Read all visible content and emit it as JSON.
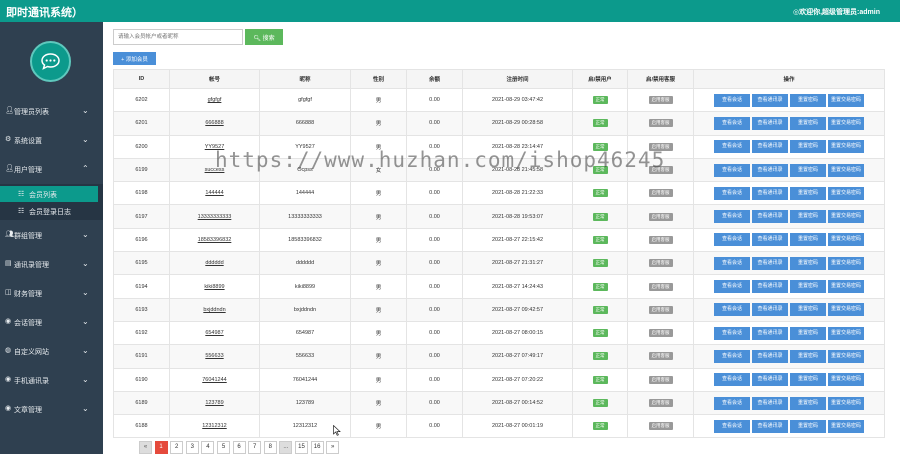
{
  "topbar": {
    "brand": "即时通讯系统）",
    "welcome": "◎欢迎你,超级管理员:admin"
  },
  "sidebar": {
    "items": [
      {
        "label": "管理员列表",
        "icon": "user-icon",
        "arrow": "⌄"
      },
      {
        "label": "系统设置",
        "icon": "gear-icon",
        "arrow": "⌄"
      },
      {
        "label": "用户管理",
        "icon": "user-icon",
        "arrow": "⌃"
      },
      {
        "label": "群组管理",
        "icon": "group-icon",
        "arrow": "⌄"
      },
      {
        "label": "通讯录管理",
        "icon": "book-icon",
        "arrow": "⌄"
      },
      {
        "label": "财务管理",
        "icon": "money-icon",
        "arrow": "⌄"
      },
      {
        "label": "会话管理",
        "icon": "chat-icon",
        "arrow": "⌄"
      },
      {
        "label": "自定义网站",
        "icon": "globe-icon",
        "arrow": "⌄"
      },
      {
        "label": "手机通讯录",
        "icon": "phone-icon",
        "arrow": "⌄"
      },
      {
        "label": "文章管理",
        "icon": "article-icon",
        "arrow": "⌄"
      }
    ],
    "subitems": [
      {
        "label": "会员列表",
        "icon": "list-icon"
      },
      {
        "label": "会员登录日志",
        "icon": "log-icon"
      }
    ]
  },
  "search": {
    "placeholder": "请输入会员帐户或者昵称",
    "button_label": "搜索",
    "add_label": "添加会员"
  },
  "table": {
    "headers": [
      "ID",
      "帐号",
      "昵称",
      "性别",
      "余额",
      "注册时间",
      "启/禁用户",
      "启/禁用客服",
      "操作"
    ],
    "rows": [
      {
        "id": "6202",
        "account": "gfgfgf",
        "nick": "gfgfgf",
        "sex": "男",
        "balance": "0.00",
        "time": "2021-08-29 03:47:42",
        "status": "正常",
        "service": "启用客服"
      },
      {
        "id": "6201",
        "account": "666888",
        "nick": "666888",
        "sex": "男",
        "balance": "0.00",
        "time": "2021-08-29 00:28:58",
        "status": "正常",
        "service": "启用客服"
      },
      {
        "id": "6200",
        "account": "YY9527",
        "nick": "YY9527",
        "sex": "男",
        "balance": "0.00",
        "time": "2021-08-28 23:14:47",
        "status": "正常",
        "service": "启用客服"
      },
      {
        "id": "6199",
        "account": "success",
        "nick": "Ocpss",
        "sex": "女",
        "balance": "0.00",
        "time": "2021-08-28 21:45:58",
        "status": "正常",
        "service": "启用客服"
      },
      {
        "id": "6198",
        "account": "144444",
        "nick": "144444",
        "sex": "男",
        "balance": "0.00",
        "time": "2021-08-28 21:22:33",
        "status": "正常",
        "service": "启用客服"
      },
      {
        "id": "6197",
        "account": "13333333333",
        "nick": "13333333333",
        "sex": "男",
        "balance": "0.00",
        "time": "2021-08-28 19:53:07",
        "status": "正常",
        "service": "启用客服"
      },
      {
        "id": "6196",
        "account": "18583396832",
        "nick": "18583396832",
        "sex": "男",
        "balance": "0.00",
        "time": "2021-08-27 22:15:42",
        "status": "正常",
        "service": "启用客服"
      },
      {
        "id": "6195",
        "account": "dddddd",
        "nick": "dddddd",
        "sex": "男",
        "balance": "0.00",
        "time": "2021-08-27 21:31:27",
        "status": "正常",
        "service": "启用客服"
      },
      {
        "id": "6194",
        "account": "kiki8899",
        "nick": "kiki8899",
        "sex": "男",
        "balance": "0.00",
        "time": "2021-08-27 14:24:43",
        "status": "正常",
        "service": "启用客服"
      },
      {
        "id": "6193",
        "account": "bxjddndn",
        "nick": "bxjddndn",
        "sex": "男",
        "balance": "0.00",
        "time": "2021-08-27 09:42:57",
        "status": "正常",
        "service": "启用客服"
      },
      {
        "id": "6192",
        "account": "654987",
        "nick": "654987",
        "sex": "男",
        "balance": "0.00",
        "time": "2021-08-27 08:00:15",
        "status": "正常",
        "service": "启用客服"
      },
      {
        "id": "6191",
        "account": "556633",
        "nick": "556633",
        "sex": "男",
        "balance": "0.00",
        "time": "2021-08-27 07:49:17",
        "status": "正常",
        "service": "启用客服"
      },
      {
        "id": "6190",
        "account": "76041244",
        "nick": "76041244",
        "sex": "男",
        "balance": "0.00",
        "time": "2021-08-27 07:20:22",
        "status": "正常",
        "service": "启用客服"
      },
      {
        "id": "6189",
        "account": "123789",
        "nick": "123789",
        "sex": "男",
        "balance": "0.00",
        "time": "2021-08-27 00:14:52",
        "status": "正常",
        "service": "启用客服"
      },
      {
        "id": "6188",
        "account": "12312312",
        "nick": "12312312",
        "sex": "男",
        "balance": "0.00",
        "time": "2021-08-27 00:01:19",
        "status": "正常",
        "service": "启用客服"
      }
    ],
    "actions": [
      "查看会话",
      "查看通讯录",
      "重置密码",
      "重置交易密码"
    ]
  },
  "pagination": {
    "prev": "«",
    "pages": [
      "1",
      "2",
      "3",
      "4",
      "5",
      "6",
      "7",
      "8",
      "...",
      "15",
      "16"
    ],
    "next": "»",
    "current": "1"
  },
  "watermark": "https://www.huzhan.com/ishop46245"
}
